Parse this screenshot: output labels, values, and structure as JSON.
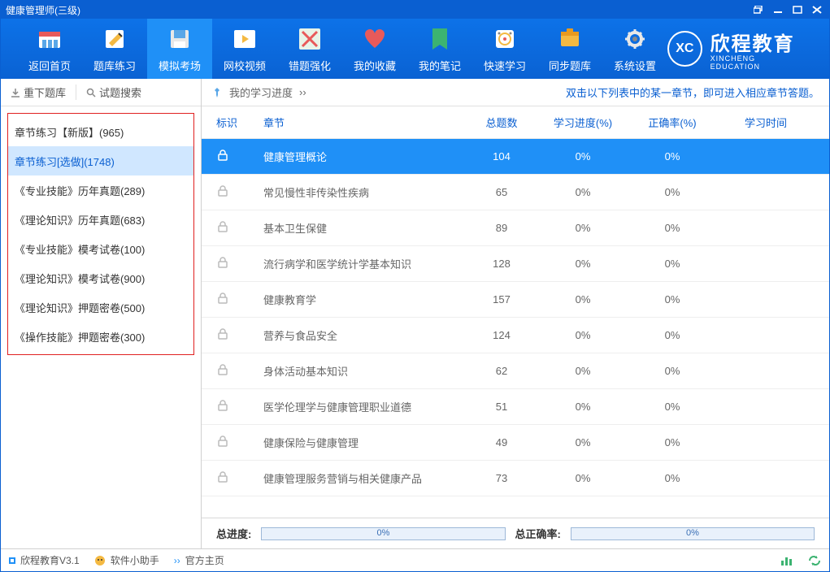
{
  "window": {
    "title": "健康管理师(三级)"
  },
  "toolbar": {
    "items": [
      {
        "label": "返回首页",
        "active": false
      },
      {
        "label": "题库练习",
        "active": false
      },
      {
        "label": "模拟考场",
        "active": true
      },
      {
        "label": "网校视频",
        "active": false
      },
      {
        "label": "错题强化",
        "active": false
      },
      {
        "label": "我的收藏",
        "active": false
      },
      {
        "label": "我的笔记",
        "active": false
      },
      {
        "label": "快速学习",
        "active": false
      },
      {
        "label": "同步题库",
        "active": false
      },
      {
        "label": "系统设置",
        "active": false
      }
    ],
    "brand": {
      "logo_text": "XC",
      "name_cn": "欣程教育",
      "name_en": "XINCHENG EDUCATION"
    }
  },
  "sidebar": {
    "top_left": "重下题库",
    "top_right": "试题搜索",
    "items": [
      {
        "label": "章节练习【新版】(965)",
        "selected": false
      },
      {
        "label": "章节练习[选做](1748)",
        "selected": true
      },
      {
        "label": "《专业技能》历年真题(289)",
        "selected": false
      },
      {
        "label": "《理论知识》历年真题(683)",
        "selected": false
      },
      {
        "label": "《专业技能》模考试卷(100)",
        "selected": false
      },
      {
        "label": "《理论知识》模考试卷(900)",
        "selected": false
      },
      {
        "label": "《理论知识》押题密卷(500)",
        "selected": false
      },
      {
        "label": "《操作技能》押题密卷(300)",
        "selected": false
      }
    ]
  },
  "main": {
    "progress_label": "我的学习进度",
    "hint": "双击以下列表中的某一章节，即可进入相应章节答题。",
    "columns": {
      "mark": "标识",
      "chapter": "章节",
      "total": "总题数",
      "progress": "学习进度(%)",
      "accuracy": "正确率(%)",
      "time": "学习时间"
    },
    "rows": [
      {
        "chapter": "健康管理概论",
        "total": "104",
        "progress": "0%",
        "accuracy": "0%",
        "selected": true
      },
      {
        "chapter": "常见慢性非传染性疾病",
        "total": "65",
        "progress": "0%",
        "accuracy": "0%",
        "selected": false
      },
      {
        "chapter": "基本卫生保健",
        "total": "89",
        "progress": "0%",
        "accuracy": "0%",
        "selected": false
      },
      {
        "chapter": "流行病学和医学统计学基本知识",
        "total": "128",
        "progress": "0%",
        "accuracy": "0%",
        "selected": false
      },
      {
        "chapter": "健康教育学",
        "total": "157",
        "progress": "0%",
        "accuracy": "0%",
        "selected": false
      },
      {
        "chapter": "营养与食品安全",
        "total": "124",
        "progress": "0%",
        "accuracy": "0%",
        "selected": false
      },
      {
        "chapter": "身体活动基本知识",
        "total": "62",
        "progress": "0%",
        "accuracy": "0%",
        "selected": false
      },
      {
        "chapter": "医学伦理学与健康管理职业道德",
        "total": "51",
        "progress": "0%",
        "accuracy": "0%",
        "selected": false
      },
      {
        "chapter": "健康保险与健康管理",
        "total": "49",
        "progress": "0%",
        "accuracy": "0%",
        "selected": false
      },
      {
        "chapter": "健康管理服务营销与相关健康产品",
        "total": "73",
        "progress": "0%",
        "accuracy": "0%",
        "selected": false
      }
    ],
    "footer": {
      "total_progress_label": "总进度:",
      "total_progress_pct": "0%",
      "total_accuracy_label": "总正确率:",
      "total_accuracy_pct": "0%"
    }
  },
  "statusbar": {
    "app": "欣程教育V3.1",
    "helper": "软件小助手",
    "homepage": "官方主页"
  }
}
